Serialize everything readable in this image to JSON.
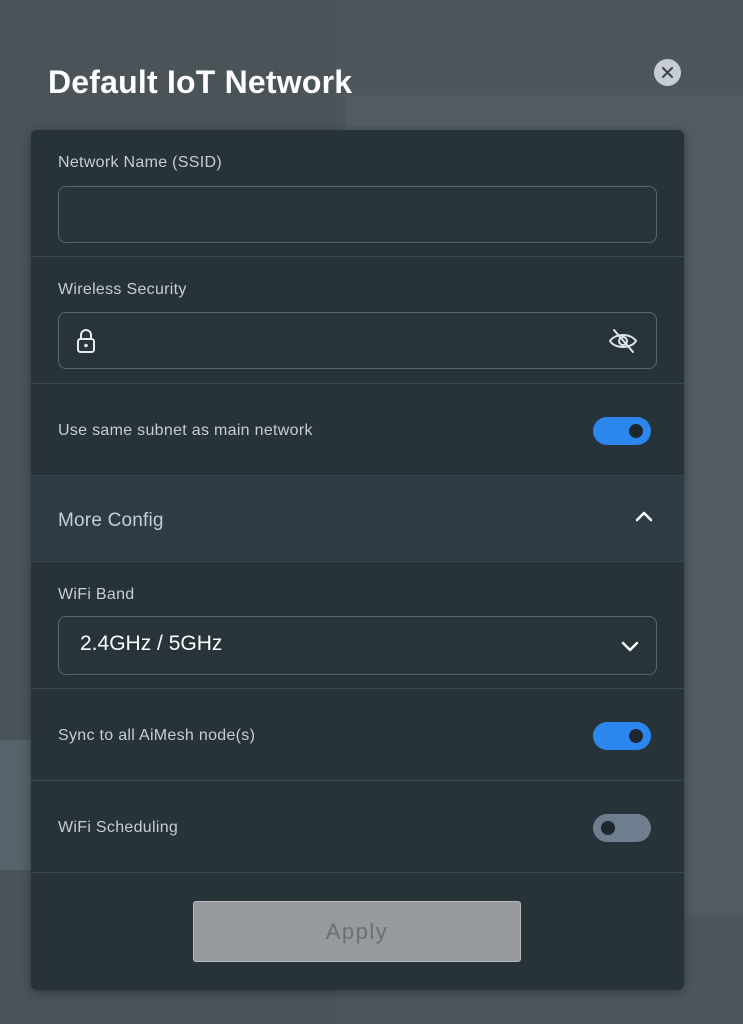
{
  "dialog": {
    "title": "Default IoT Network",
    "close_icon": "close-icon"
  },
  "network_name": {
    "label": "Network Name (SSID)",
    "value": ""
  },
  "wireless_security": {
    "label": "Wireless Security",
    "value": "",
    "lock_icon": "lock-icon",
    "visibility_icon": "eye-slash-icon"
  },
  "same_subnet": {
    "label": "Use same subnet as main network",
    "enabled": true
  },
  "more_config": {
    "label": "More Config",
    "icon": "chevron-up-icon",
    "expanded": true
  },
  "wifi_band": {
    "label": "WiFi Band",
    "selected": "2.4GHz / 5GHz",
    "icon": "chevron-down-icon"
  },
  "sync_aimesh": {
    "label": "Sync to all AiMesh node(s)",
    "enabled": true
  },
  "wifi_scheduling": {
    "label": "WiFi Scheduling",
    "enabled": false
  },
  "apply": {
    "label": "Apply",
    "disabled": true
  },
  "colors": {
    "accent": "#2b86ee",
    "card_bg": "#283239",
    "toggle_off": "#6e7e8e",
    "button_disabled": "#979a9d"
  }
}
